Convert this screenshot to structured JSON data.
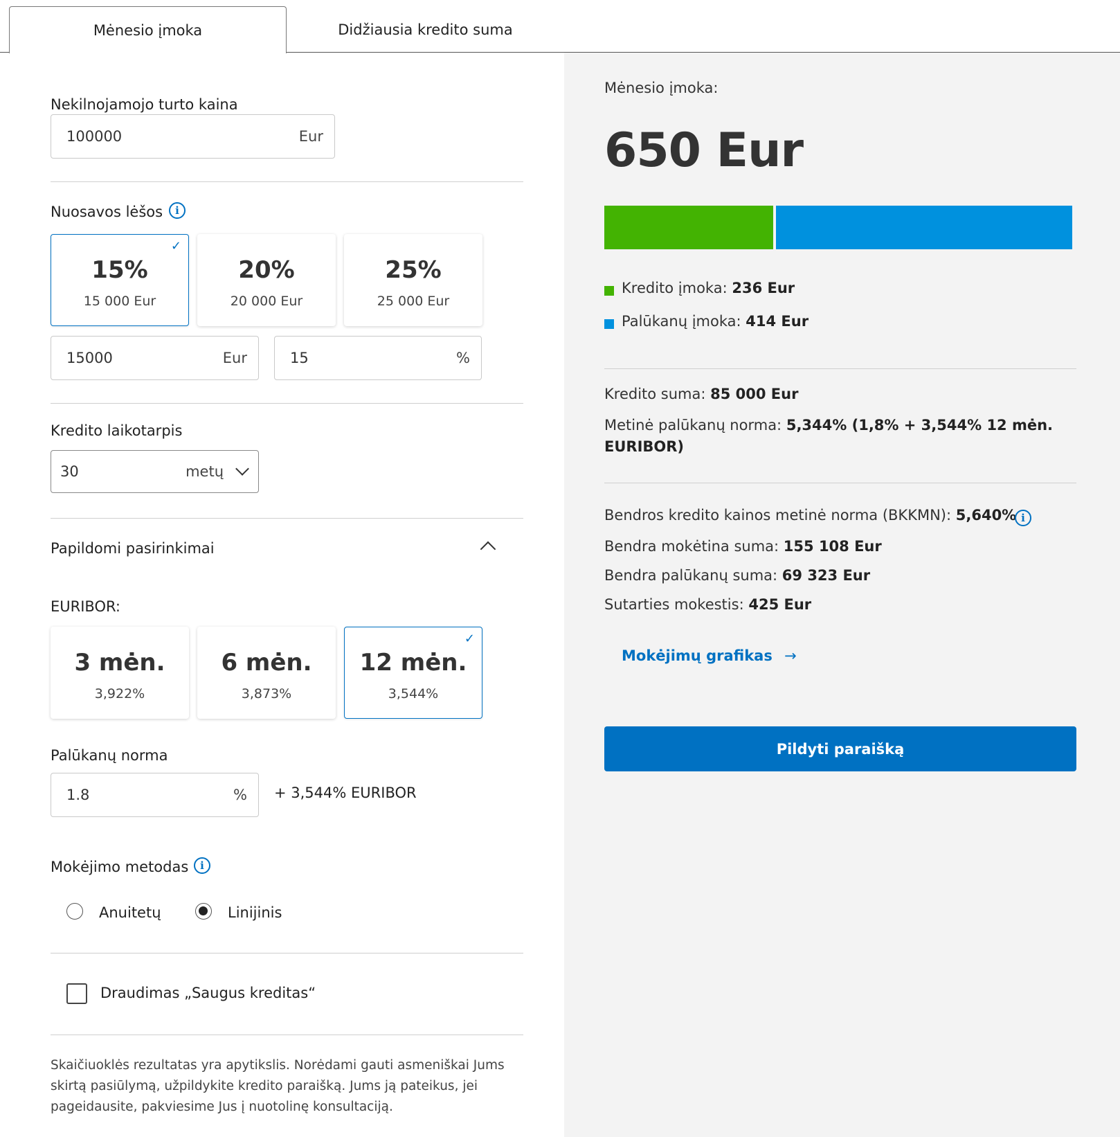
{
  "tabs": [
    {
      "label": "Mėnesio įmoka",
      "active": true
    },
    {
      "label": "Didžiausia kredito suma",
      "active": false
    }
  ],
  "property_price": {
    "label": "Nekilnojamojo turto kaina",
    "value": "100000",
    "unit": "Eur"
  },
  "own_funds": {
    "label": "Nuosavos lėšos",
    "options": [
      {
        "percent": "15%",
        "amount": "15 000 Eur",
        "selected": true
      },
      {
        "percent": "20%",
        "amount": "20 000 Eur",
        "selected": false
      },
      {
        "percent": "25%",
        "amount": "25 000 Eur",
        "selected": false
      }
    ],
    "amount_value": "15000",
    "amount_unit": "Eur",
    "percent_value": "15",
    "percent_unit": "%"
  },
  "credit_term": {
    "label": "Kredito laikotarpis",
    "value": "30",
    "unit": "metų"
  },
  "additional": {
    "label": "Papildomi pasirinkimai",
    "expanded": true
  },
  "euribor": {
    "label": "EURIBOR:",
    "options": [
      {
        "term": "3 mėn.",
        "rate": "3,922%",
        "selected": false
      },
      {
        "term": "6 mėn.",
        "rate": "3,873%",
        "selected": false
      },
      {
        "term": "12 mėn.",
        "rate": "3,544%",
        "selected": true
      }
    ]
  },
  "interest_rate": {
    "label": "Palūkanų norma",
    "value": "1.8",
    "unit": "%",
    "suffix": "+ 3,544% EURIBOR"
  },
  "payment_method": {
    "label": "Mokėjimo metodas",
    "options": [
      {
        "label": "Anuitetų",
        "checked": false
      },
      {
        "label": "Linijinis",
        "checked": true
      }
    ]
  },
  "insurance": {
    "label": "Draudimas „Saugus kreditas“",
    "checked": false
  },
  "disclaimer": "Skaičiuoklės rezultatas yra apytikslis. Norėdami gauti asmeniškai Jums skirtą pasiūlymą, užpildykite kredito paraišką. Jums ją pateikus, jei pageidausite, pakviesime Jus į nuotolinę konsultaciją.",
  "result": {
    "heading": "Mėnesio įmoka:",
    "amount": "650",
    "currency": "Eur",
    "bar": {
      "credit_share": 236,
      "interest_share": 414
    },
    "legend": [
      {
        "label": "Kredito įmoka:",
        "value": "236 Eur",
        "color": "#43b302"
      },
      {
        "label": "Palūkanų įmoka:",
        "value": "414 Eur",
        "color": "#0091de"
      }
    ],
    "credit_sum_label": "Kredito suma:",
    "credit_sum_value": "85 000 Eur",
    "annual_rate_label": "Metinė palūkanų norma:",
    "annual_rate_value": "5,344% (1,8% + 3,544% 12 mėn.",
    "annual_rate_value_cont": "EURIBOR)",
    "bkkmn_label": "Bendros kredito kainos metinė norma (BKKMN):",
    "bkkmn_value": "5,640%",
    "total_payable_label": "Bendra mokėtina suma:",
    "total_payable_value": "155 108 Eur",
    "total_interest_label": "Bendra palūkanų suma:",
    "total_interest_value": "69 323 Eur",
    "contract_fee_label": "Sutarties mokestis:",
    "contract_fee_value": "425 Eur",
    "schedule_link": "Mokėjimų grafikas",
    "apply_button": "Pildyti paraišką"
  },
  "colors": {
    "accent": "#0071c2",
    "green": "#43b302",
    "blue": "#0091de"
  }
}
